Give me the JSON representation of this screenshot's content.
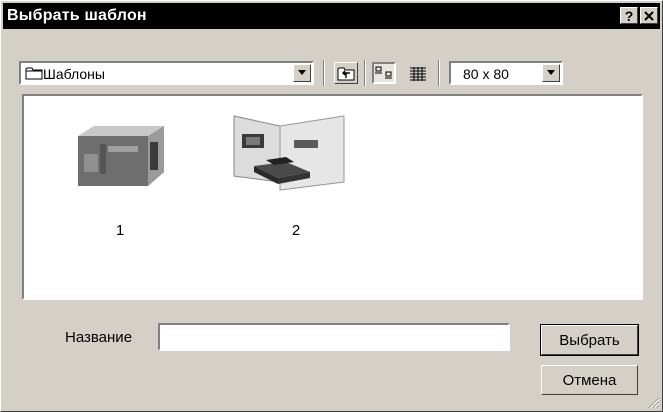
{
  "window": {
    "title": "Выбрать шаблон",
    "help_label": "?",
    "close_label": "✕"
  },
  "toolbar": {
    "folder_value": "Шаблоны",
    "size_value": "80 x 80",
    "icons": [
      "folder-icon",
      "up-folder-icon",
      "large-icons-view-icon",
      "list-view-icon",
      "chevron-down-icon"
    ]
  },
  "templates": [
    {
      "label": "1"
    },
    {
      "label": "2"
    }
  ],
  "form": {
    "name_label": "Название",
    "name_value": "",
    "select_button": "Выбрать",
    "cancel_button": "Отмена"
  }
}
